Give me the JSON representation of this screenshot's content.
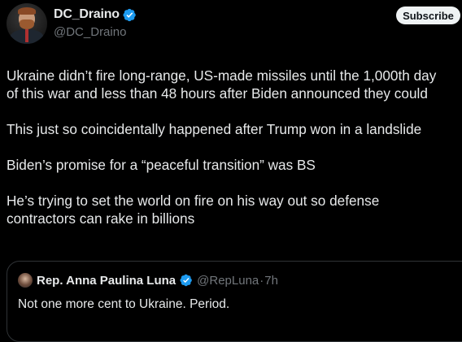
{
  "author": {
    "display_name": "DC_Draino",
    "handle": "@DC_Draino",
    "verified": true,
    "avatar": "profile-photo"
  },
  "subscribe_label": "Subscribe",
  "tweet": {
    "paragraphs": [
      "Ukraine didn’t fire long-range, US-made missiles until the 1,000th day\nof this war and less than 48 hours after Biden announced they could",
      "This just so coincidentally happened after Trump won in a landslide",
      "Biden’s promise for a “peaceful transition” was BS",
      "He’s trying to set the world on fire on his way out so defense\ncontractors can rake in billions"
    ]
  },
  "quoted_tweet": {
    "display_name": "Rep. Anna Paulina Luna",
    "handle": "@RepLuna",
    "separator": "·",
    "time": "7h",
    "verified": true,
    "text": "Not one more cent to Ukraine. Period."
  },
  "colors": {
    "background": "#000000",
    "text_primary": "#e7e9ea",
    "text_secondary": "#71767b",
    "verified_badge": "#1d9bf0",
    "border": "#2f3336",
    "button_bg": "#eff3f4"
  }
}
